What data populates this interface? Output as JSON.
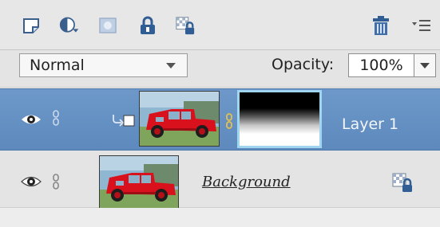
{
  "toolbar": {
    "icons": [
      "new-layer-icon",
      "adjustment-layer-icon",
      "layer-mask-icon",
      "lock-all-icon",
      "lock-transparency-icon",
      "trash-icon",
      "panel-menu-icon"
    ]
  },
  "blend": {
    "mode": "Normal",
    "opacity_label": "Opacity:",
    "opacity_value": "100%"
  },
  "layers": [
    {
      "name": "Layer 1",
      "selected": true,
      "visible": true,
      "has_mask": true
    },
    {
      "name": "Background",
      "selected": false,
      "visible": true,
      "locked": true
    }
  ],
  "colors": {
    "selection": "#5d89bd",
    "panel_bg": "#e4e4e4",
    "icon_blue": "#3f6ea8",
    "car_red": "#d8111c"
  }
}
